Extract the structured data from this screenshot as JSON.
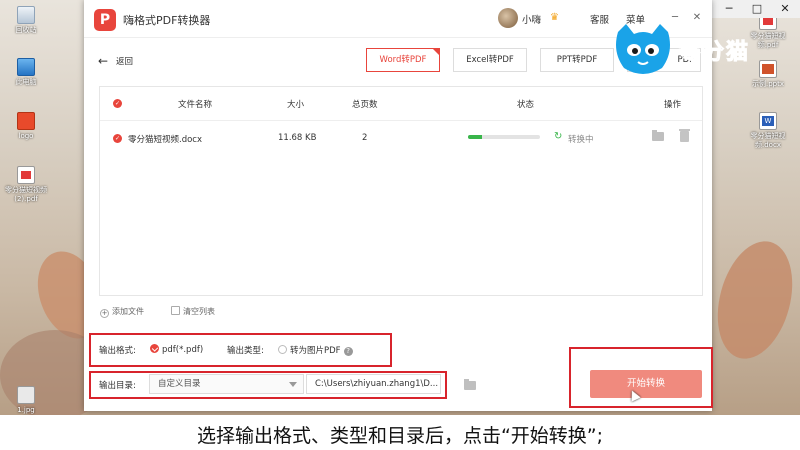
{
  "desktop": {
    "icons": [
      {
        "label": "回收站",
        "kind": "bin"
      },
      {
        "label": "此电脑",
        "kind": "pc"
      },
      {
        "label": "logo",
        "kind": "logo"
      },
      {
        "label": "零分猫短视频(2).pdf",
        "kind": "pdf"
      },
      {
        "label": "1.jpg",
        "kind": "img"
      },
      {
        "label": "零分猫短视频.pdf",
        "kind": "pdf"
      },
      {
        "label": "示例.pptx",
        "kind": "ppt"
      },
      {
        "label": "零分猫短视频.docx",
        "kind": "doc"
      }
    ]
  },
  "app": {
    "title": "嗨格式PDF转换器",
    "logo_text": "P",
    "user_name": "小嗨",
    "service_label": "客服",
    "menu_label": "菜单",
    "back_label": "返回",
    "tabs": [
      {
        "label": "Word转PDF",
        "active": true
      },
      {
        "label": "Excel转PDF",
        "active": false
      },
      {
        "label": "PPT转PDF",
        "active": false
      },
      {
        "label": "PDF",
        "active": false
      }
    ],
    "table": {
      "headers": {
        "name": "文件名称",
        "size": "大小",
        "pages": "总页数",
        "status": "状态",
        "ops": "操作"
      },
      "rows": [
        {
          "name": "零分猫短视频.docx",
          "size": "11.68 KB",
          "pages": "2",
          "progress": 0.2,
          "status": "转换中"
        }
      ]
    },
    "add_file_label": "添加文件",
    "clear_list_label": "清空列表",
    "output": {
      "format_label": "输出格式:",
      "format_value": "pdf(*.pdf)",
      "type_label": "输出类型:",
      "type_value": "转为图片PDF",
      "dir_label": "输出目录:",
      "dir_select": "自定义目录",
      "dir_path": "C:\\Users\\zhiyuan.zhang1\\D..."
    },
    "start_button": "开始转换"
  },
  "watermark": {
    "text": "零分猫"
  },
  "subtitle": "选择输出格式、类型和目录后，点击“开始转换”;",
  "colors": {
    "accent": "#e8453c",
    "highlight": "#d8242c",
    "progress": "#39b54a",
    "button": "#f08a7e"
  }
}
